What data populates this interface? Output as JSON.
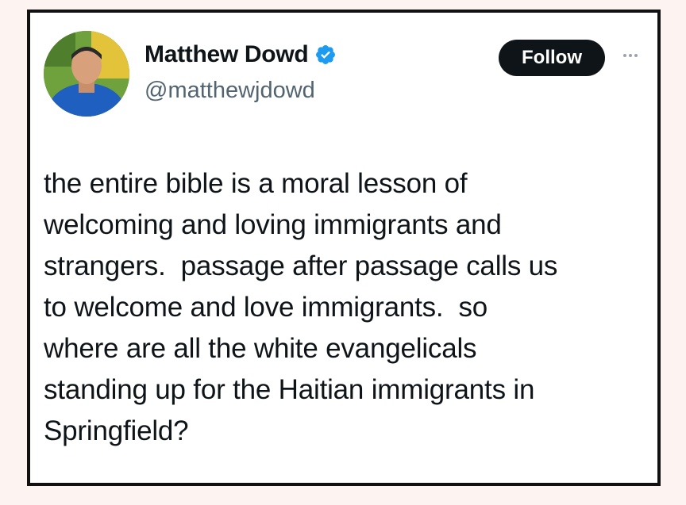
{
  "author": {
    "display_name": "Matthew Dowd",
    "handle": "@matthewjdowd",
    "verified": true,
    "avatar_icon": "profile-photo",
    "verified_icon": "verified-badge-icon"
  },
  "actions": {
    "follow_label": "Follow",
    "more_icon": "more-options-icon"
  },
  "tweet": {
    "lines": [
      "the entire bible is a moral lesson of",
      "welcoming and loving immigrants and",
      "strangers.  passage after passage calls us",
      "to welcome and love immigrants.  so",
      "where are all the white evangelicals",
      "standing up for the Haitian immigrants in",
      "Springfield?"
    ]
  },
  "colors": {
    "page_background": "#fdf3f1",
    "card_border": "#111111",
    "verified_blue": "#1d9bf0",
    "follow_button_bg": "#0f1419",
    "text_primary": "#0f1419",
    "text_secondary": "#536471"
  }
}
